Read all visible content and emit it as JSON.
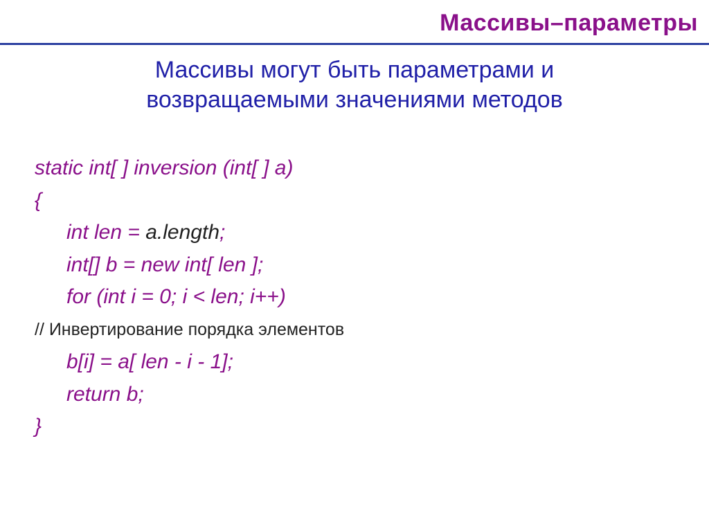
{
  "title": "Массивы–параметры",
  "subtitle_line1": "Массивы могут быть параметрами и",
  "subtitle_line2": "возвращаемыми значениями методов",
  "code": {
    "l1": "static int[ ] inversion (int[ ] a)",
    "l2": "{",
    "l3a": "int len = ",
    "l3b": "a.length",
    "l3c": ";",
    "l4": "int[] b = new int[ len ];",
    "l5": "for (int i = 0; i < len; i++)",
    "comment": "// Инвертирование порядка элементов",
    "l6": "b[i] = a[ len - i - 1];",
    "l7": "return b;",
    "l8": "}"
  }
}
